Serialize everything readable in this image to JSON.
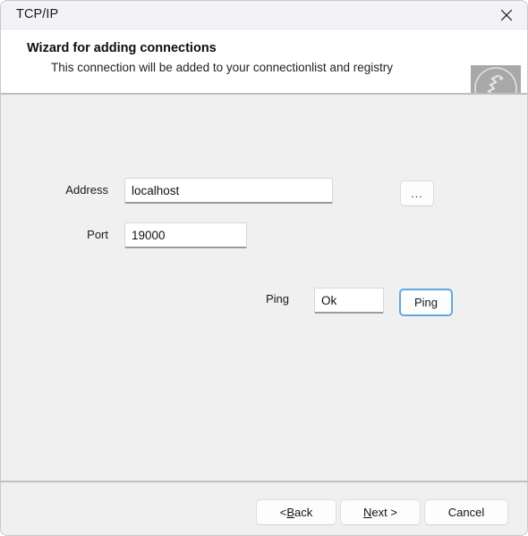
{
  "window": {
    "title": "TCP/IP",
    "close_icon": "close-icon"
  },
  "header": {
    "title": "Wizard for adding connections",
    "subtitle": "This connection will be added to your connectionlist and registry",
    "logo_alt": "vendor-logo"
  },
  "form": {
    "address": {
      "label": "Address",
      "value": "localhost",
      "placeholder": ""
    },
    "port": {
      "label": "Port",
      "value": "19000",
      "placeholder": ""
    },
    "ping": {
      "label": "Ping",
      "value": "Ok",
      "placeholder": "",
      "button_label": "Ping"
    },
    "browse_button_label": "..."
  },
  "footer": {
    "back": {
      "prefix": "< ",
      "accel": "B",
      "suffix": "ack"
    },
    "next": {
      "prefix": "",
      "accel": "N",
      "suffix": "ext >"
    },
    "cancel": {
      "label": "Cancel"
    }
  },
  "colors": {
    "window_bg": "#f0f0f0",
    "titlebar_bg": "#f3f3f7",
    "header_bg": "#ffffff",
    "focus_blue": "#61a8e2",
    "logo_grey": "#a8a8a8",
    "separator": "#bfbfbf"
  }
}
